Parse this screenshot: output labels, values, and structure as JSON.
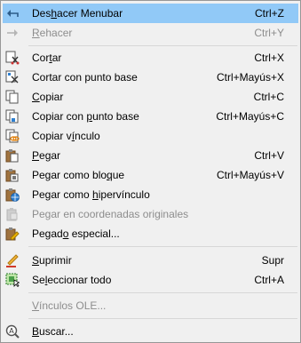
{
  "menu": {
    "items": [
      {
        "pre": "Des",
        "key": "h",
        "post": "acer Menubar",
        "shortcut": "Ctrl+Z"
      },
      {
        "pre": "",
        "key": "R",
        "post": "ehacer",
        "shortcut": "Ctrl+Y"
      },
      {
        "pre": "Cor",
        "key": "t",
        "post": "ar",
        "shortcut": "Ctrl+X"
      },
      {
        "pre": "Cortar con punto base",
        "key": "",
        "post": "",
        "shortcut": "Ctrl+Mayús+X"
      },
      {
        "pre": "",
        "key": "C",
        "post": "opiar",
        "shortcut": "Ctrl+C"
      },
      {
        "pre": "Copiar con ",
        "key": "p",
        "post": "unto base",
        "shortcut": "Ctrl+Mayús+C"
      },
      {
        "pre": "Copiar v",
        "key": "í",
        "post": "nculo",
        "shortcut": ""
      },
      {
        "pre": "",
        "key": "P",
        "post": "egar",
        "shortcut": "Ctrl+V"
      },
      {
        "pre": "Pegar como blo",
        "key": "q",
        "post": "ue",
        "shortcut": "Ctrl+Mayús+V"
      },
      {
        "pre": "Pegar como ",
        "key": "h",
        "post": "ipervínculo",
        "shortcut": ""
      },
      {
        "pre": "Pegar en coordenadas originales",
        "key": "",
        "post": "",
        "shortcut": ""
      },
      {
        "pre": "Pegad",
        "key": "o",
        "post": " especial...",
        "shortcut": ""
      },
      {
        "pre": "",
        "key": "S",
        "post": "uprimir",
        "shortcut": "Supr"
      },
      {
        "pre": "Se",
        "key": "l",
        "post": "eccionar todo",
        "shortcut": "Ctrl+A"
      },
      {
        "pre": "",
        "key": "V",
        "post": "ínculos OLE...",
        "shortcut": ""
      },
      {
        "pre": "",
        "key": "B",
        "post": "uscar...",
        "shortcut": ""
      }
    ]
  },
  "colors": {
    "highlight": "#91c9f7",
    "menu_bg": "#f0f0f0",
    "disabled_text": "#8d8d8d"
  },
  "icons": [
    "undo-icon",
    "redo-icon",
    "cut-icon",
    "cut-basepoint-icon",
    "copy-icon",
    "copy-basepoint-icon",
    "copy-link-icon",
    "paste-icon",
    "paste-block-icon",
    "paste-hyperlink-icon",
    "paste-original-coords-icon",
    "paste-special-icon",
    "erase-icon",
    "select-all-icon",
    "find-icon"
  ]
}
